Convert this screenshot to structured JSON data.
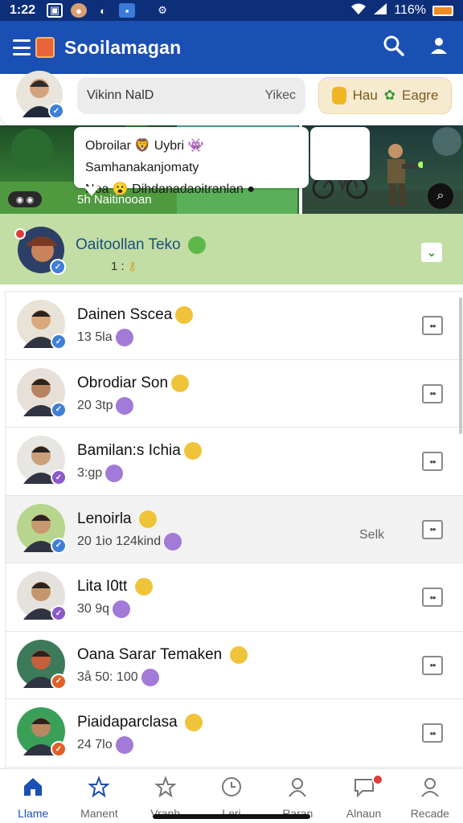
{
  "status_bar": {
    "time": "1:22",
    "battery_text": "116%"
  },
  "app_bar": {
    "title": "Sooilamagan"
  },
  "profile_row": {
    "search_text": "Vikinn NalD",
    "search_right": "Yikec",
    "tag_text": "Hau",
    "tag_extra": "Eagre"
  },
  "banner": {
    "bubble_line1": "Obroilar 🦁 Uybri 👾 Samhanakanjomaty",
    "bubble_line2": "Noa 😮 Dihdanadaoitranlan ●",
    "caption": "5h Naitinooan"
  },
  "highlight": {
    "name": "Oaitoollan Teko",
    "sub": "1 :"
  },
  "contacts": [
    {
      "name": "Dainen",
      "name_extra": "Sscea",
      "sub": "13 5la",
      "side": "",
      "badge_color": "#3f7fd6",
      "skin": "#d9a87c",
      "bg": "#e9e2d6"
    },
    {
      "name": "Obrodiar",
      "name_extra": "Son",
      "sub": "20 3tp",
      "side": "",
      "badge_color": "#3f7fd6",
      "skin": "#b8845f",
      "bg": "#e6e0d8"
    },
    {
      "name": "Bamilan:s",
      "name_extra": "Ichia",
      "sub": "3:gp",
      "side": "",
      "badge_color": "#8a5ac8",
      "skin": "#caa07a",
      "bg": "#e8e6e2"
    },
    {
      "name": "Lenoirla",
      "name_extra": "",
      "sub": "20  1io  124kind",
      "side": "Selk",
      "badge_color": "#3f7fd6",
      "skin": "#c89870",
      "bg": "#b7d58d"
    },
    {
      "name": "Lita I0tt",
      "name_extra": "",
      "sub": "30 9q",
      "side": "",
      "badge_color": "#8a5ac8",
      "skin": "#c5956b",
      "bg": "#e5e2de"
    },
    {
      "name": "Oana Sarar Temaken",
      "name_extra": "",
      "sub": "3å 50: 100",
      "side": "",
      "badge_color": "#e0602a",
      "skin": "#c7603a",
      "bg": "#3c7a5a"
    },
    {
      "name": "Piaidaparclasa",
      "name_extra": "",
      "sub": "24 7lo",
      "side": "",
      "badge_color": "#e0602a",
      "skin": "#b98760",
      "bg": "#3aa058"
    }
  ],
  "bottom_nav": [
    {
      "label": "Llame",
      "icon": "home-icon",
      "active": true
    },
    {
      "label": "Manent",
      "icon": "star-outline-icon",
      "active": false
    },
    {
      "label": "Vranh",
      "icon": "star-icon",
      "active": false
    },
    {
      "label": "Leri",
      "icon": "clock-icon",
      "active": false
    },
    {
      "label": "Raran",
      "icon": "profile-icon",
      "active": false
    },
    {
      "label": "Alnaun",
      "icon": "chat-icon",
      "active": false,
      "badge": true
    },
    {
      "label": "Recade",
      "icon": "user-icon",
      "active": false
    }
  ],
  "colors": {
    "appbar": "#1a4fb4",
    "statusbar": "#0d2f7a",
    "highlight": "#c2dea4",
    "accent": "#1a4fb4"
  }
}
